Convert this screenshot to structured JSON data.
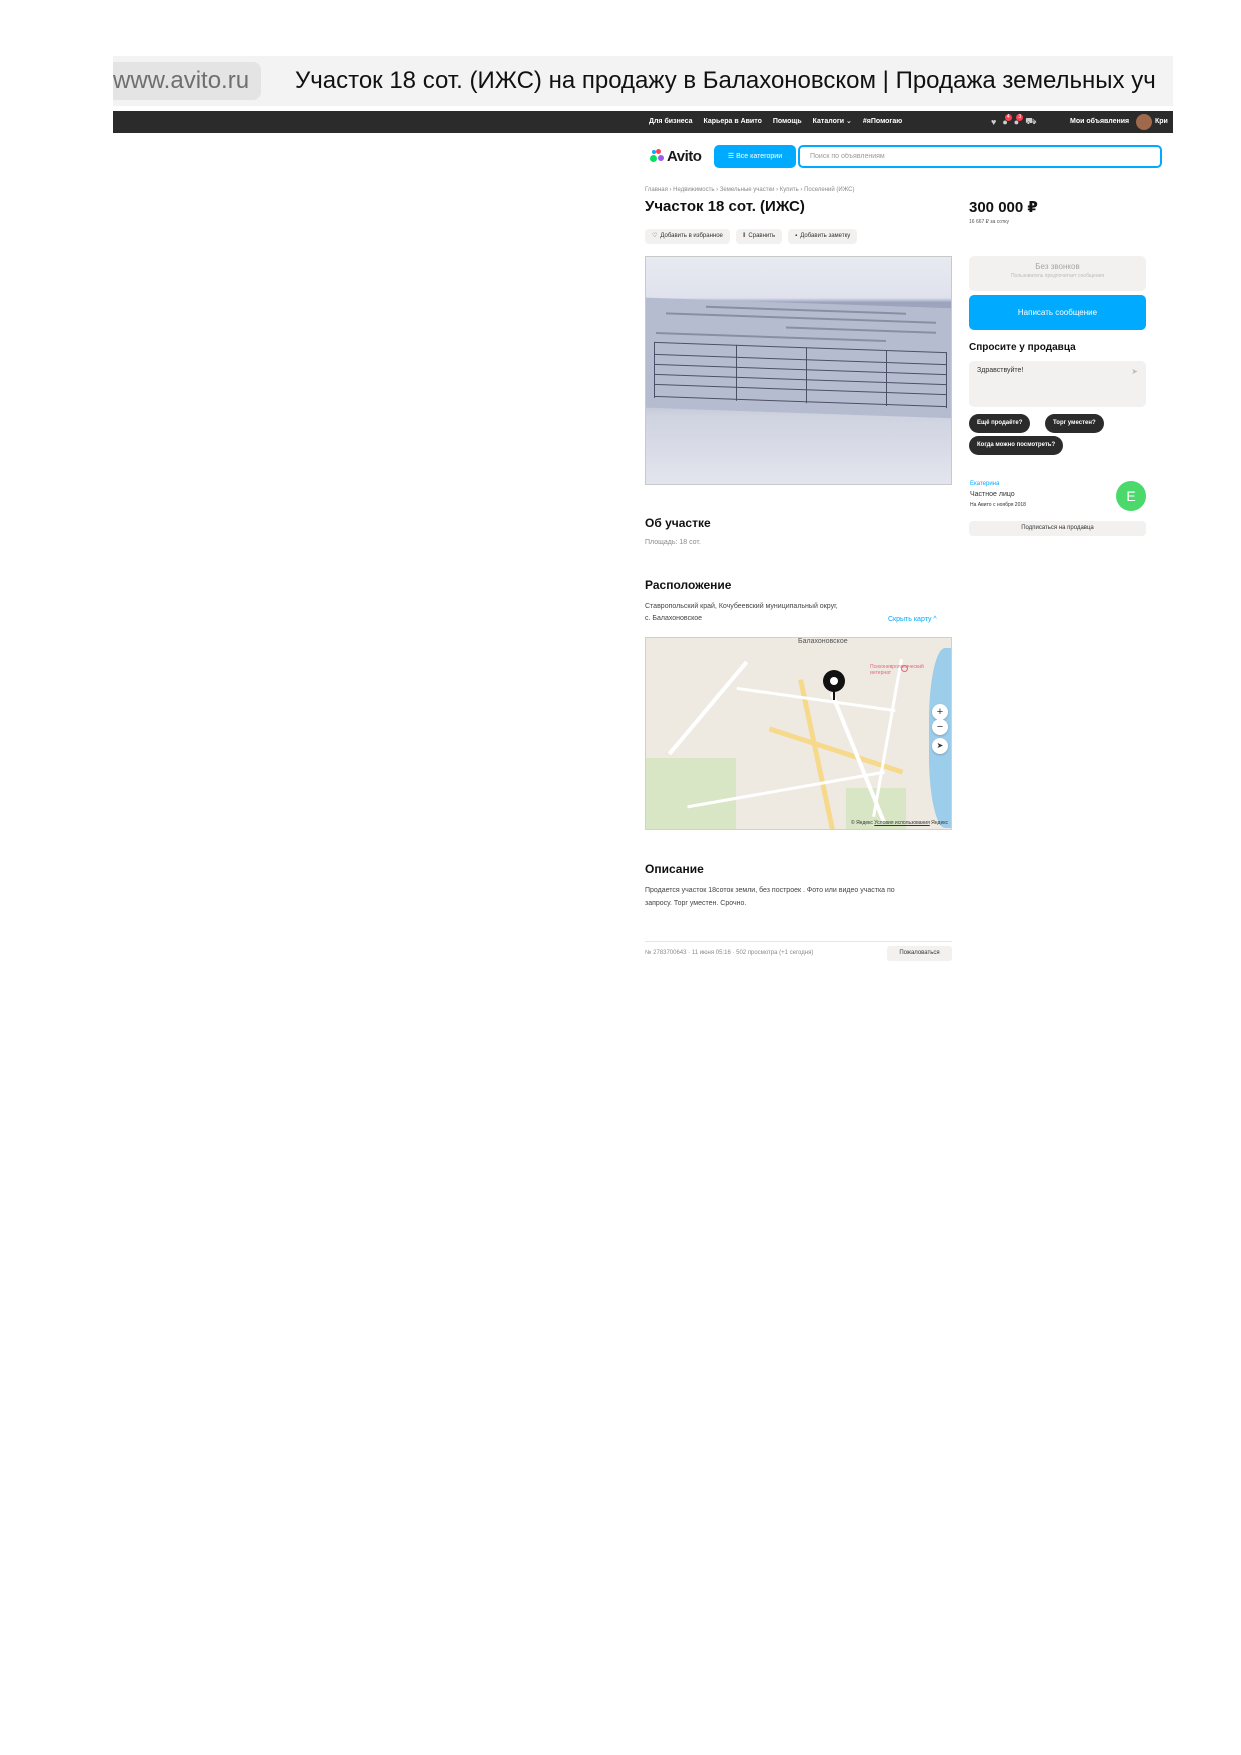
{
  "browser": {
    "url": "www.avito.ru",
    "tab_title": "Участок 18 сот. (ИЖС) на продажу в Балахоновском | Продажа земельных уч"
  },
  "topnav": {
    "links": [
      "Для бизнеса",
      "Карьера в Авито",
      "Помощь",
      "Каталоги ⌄",
      "#яПомогаю"
    ],
    "icons": [
      "heart-icon",
      "bell-icon",
      "chat-icon",
      "cart-icon"
    ],
    "badges": [
      "4",
      "3"
    ],
    "my_ads": "Мои объявления",
    "user": "Кри"
  },
  "header": {
    "logo": "Avito",
    "all_categories": "☰ Все категории",
    "search_placeholder": "Поиск по объявлениям",
    "accent_color": "#00aaff"
  },
  "breadcrumb": "Главная › Недвижимость › Земельные участки › Купить › Поселений (ИЖС)",
  "listing": {
    "title": "Участок 18 сот. (ИЖС)",
    "actions": [
      "Добавить в избранное",
      "Сравнить",
      "Добавить заметку"
    ],
    "about_title": "Об участке",
    "area": "Площадь: 18 сот.",
    "location_title": "Расположение",
    "address_line1": "Ставропольский край, Кочубеевский муниципальный округ,",
    "address_line2": "с. Балахоновское",
    "hide_map": "Скрыть карту ^",
    "map": {
      "town": "Балахоновское",
      "poi": "Психоневрологический интернат",
      "zoom_in": "+",
      "zoom_out": "−",
      "copyright": "© Яндекс",
      "terms": "Условия использования",
      "brand": "Яндекс"
    },
    "description_title": "Описание",
    "description_line1": "Продается участок 18соток земли, без построек . Фото или видео участка по",
    "description_line2": "запросу. Торг уместен. Срочно.",
    "footer_meta": "№ 2783700643 · 11 июня 05:16 · 502 просмотра (+1 сегодня)",
    "complain": "Пожаловаться"
  },
  "sidebar": {
    "price": "300 000 ₽",
    "per_unit": "16 667 ₽ за сотку",
    "no_calls": "Без звонков",
    "no_calls_sub": "Пользователь предпочитает сообщения",
    "write_message": "Написать сообщение",
    "ask_title": "Спросите у продавца",
    "ask_text": "Здравствуйте!",
    "chips": [
      "Ещё продаёте?",
      "Торг уместен?",
      "Когда можно посмотреть?"
    ],
    "seller_name": "Екатерина",
    "seller_type": "Частное лицо",
    "seller_since": "На Авито с ноября 2018",
    "avatar_letter": "Е",
    "subscribe": "Подписаться на продавца"
  }
}
